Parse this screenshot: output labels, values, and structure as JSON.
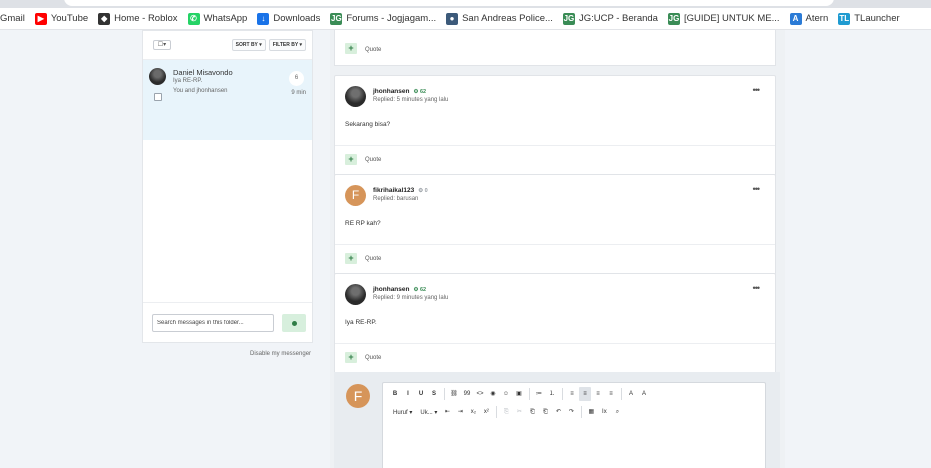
{
  "bookmarks": [
    {
      "label": "Gmail",
      "icon": "gmail-icon",
      "glyph": "M",
      "color": "#ea4335"
    },
    {
      "label": "YouTube",
      "icon": "youtube-icon",
      "glyph": "▶",
      "color": "#ff0000"
    },
    {
      "label": "Home - Roblox",
      "icon": "roblox-icon",
      "glyph": "◆",
      "color": "#333333"
    },
    {
      "label": "WhatsApp",
      "icon": "whatsapp-icon",
      "glyph": "✆",
      "color": "#25d366"
    },
    {
      "label": "Downloads",
      "icon": "download-icon",
      "glyph": "↓",
      "color": "#1a73e8"
    },
    {
      "label": "Forums - Jogjagam...",
      "icon": "jg-forum-icon",
      "glyph": "JG",
      "color": "#3a8c56"
    },
    {
      "label": "San Andreas Police...",
      "icon": "police-icon",
      "glyph": "●",
      "color": "#3c5a7a"
    },
    {
      "label": "JG:UCP - Beranda",
      "icon": "jg-ucp-icon",
      "glyph": "JG",
      "color": "#3a8c56"
    },
    {
      "label": "[GUIDE] UNTUK ME...",
      "icon": "jg-guide-icon",
      "glyph": "JG",
      "color": "#3a8c56"
    },
    {
      "label": "Atern",
      "icon": "atern-icon",
      "glyph": "A",
      "color": "#2b7bd6"
    },
    {
      "label": "TLauncher",
      "icon": "tlauncher-icon",
      "glyph": "TL",
      "color": "#1f9bd1"
    }
  ],
  "list": {
    "select_label": "☐▾",
    "sort_by": "SORT BY ▾",
    "filter_by": "FILTER BY ▾",
    "conversation": {
      "name": "Daniel Misavondo",
      "snippet": "Iya RE-RP.",
      "participants": "You and jhonhansen",
      "count": "6",
      "time": "9 min"
    },
    "search_placeholder": "Search messages in this folder...",
    "disable_link": "Disable my messenger"
  },
  "quote_label": "Quote",
  "messages": [
    {
      "author": "jhonhansen",
      "rep": "62",
      "rep_color": "#3a8c56",
      "replied": "Replied: 5 minutes yang lalu",
      "body": "Sekarang bisa?"
    },
    {
      "author": "fikrihaikal123",
      "rep": "0",
      "rep_color": "#9aa0a6",
      "replied": "Replied: barusan",
      "body": "RE RP kah?"
    },
    {
      "author": "jhonhansen",
      "rep": "62",
      "rep_color": "#3a8c56",
      "replied": "Replied: 9 minutes yang lalu",
      "body": "Iya RE-RP."
    }
  ],
  "avatar_letter": "F",
  "editor": {
    "toolbar_row1": [
      "B",
      "I",
      "U",
      "S",
      "|",
      "⛓",
      "99",
      "<>",
      "◉",
      "☺",
      "▣",
      "|",
      "≔",
      "⒈",
      "|",
      "≡",
      "≡",
      "≡",
      "≡",
      "|",
      "A",
      "A"
    ],
    "font_label": "Huruf",
    "size_label": "Uk...",
    "toolbar_row2": [
      "⇤",
      "⇥",
      "x₂",
      "x²",
      "|",
      "⎘",
      "✂",
      "⎗",
      "⎗",
      "↶",
      "↷",
      "|",
      "▦",
      "Ix",
      "⌕"
    ]
  }
}
